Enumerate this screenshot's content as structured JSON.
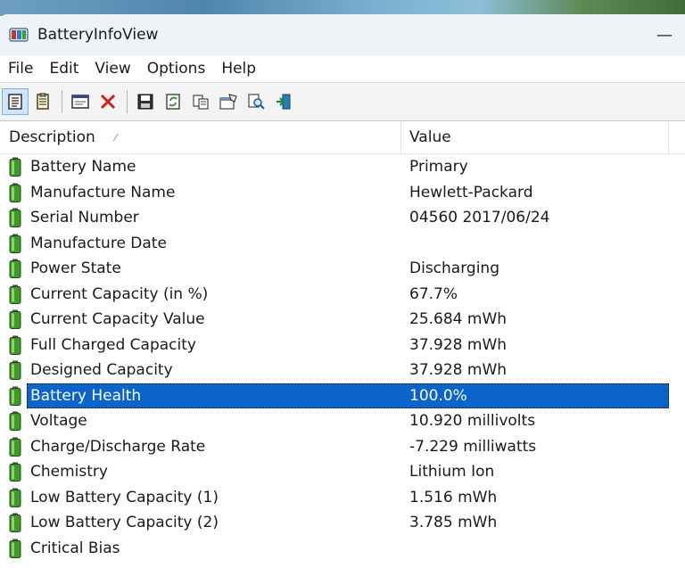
{
  "window": {
    "title": "BatteryInfoView",
    "minimize_glyph": "—"
  },
  "menu": [
    "File",
    "Edit",
    "View",
    "Options",
    "Help"
  ],
  "toolbar": {
    "icons": [
      "html-report-icon",
      "properties-icon",
      "window-icon",
      "delete-icon",
      "save-icon",
      "refresh-icon",
      "copy-icon",
      "properties-dialog-icon",
      "find-icon",
      "exit-icon"
    ]
  },
  "table": {
    "columns": [
      "Description",
      "Value"
    ],
    "sort_glyph": "⁄",
    "selected_index": 9,
    "rows": [
      {
        "desc": "Battery Name",
        "value": "Primary"
      },
      {
        "desc": "Manufacture Name",
        "value": "Hewlett-Packard"
      },
      {
        "desc": "Serial Number",
        "value": "04560 2017/06/24"
      },
      {
        "desc": "Manufacture Date",
        "value": ""
      },
      {
        "desc": "Power State",
        "value": "Discharging"
      },
      {
        "desc": "Current Capacity (in %)",
        "value": "67.7%"
      },
      {
        "desc": "Current Capacity Value",
        "value": "25.684 mWh"
      },
      {
        "desc": "Full Charged Capacity",
        "value": "37.928 mWh"
      },
      {
        "desc": "Designed Capacity",
        "value": "37.928 mWh"
      },
      {
        "desc": "Battery Health",
        "value": "100.0%"
      },
      {
        "desc": "Voltage",
        "value": "10.920 millivolts"
      },
      {
        "desc": "Charge/Discharge Rate",
        "value": "-7.229 milliwatts"
      },
      {
        "desc": "Chemistry",
        "value": "Lithium Ion"
      },
      {
        "desc": "Low Battery Capacity (1)",
        "value": "1.516 mWh"
      },
      {
        "desc": "Low Battery Capacity (2)",
        "value": "3.785 mWh"
      },
      {
        "desc": "Critical Bias",
        "value": ""
      }
    ]
  },
  "colors": {
    "selection": "#0a64c9",
    "battery_green": "#3f9a2a"
  }
}
